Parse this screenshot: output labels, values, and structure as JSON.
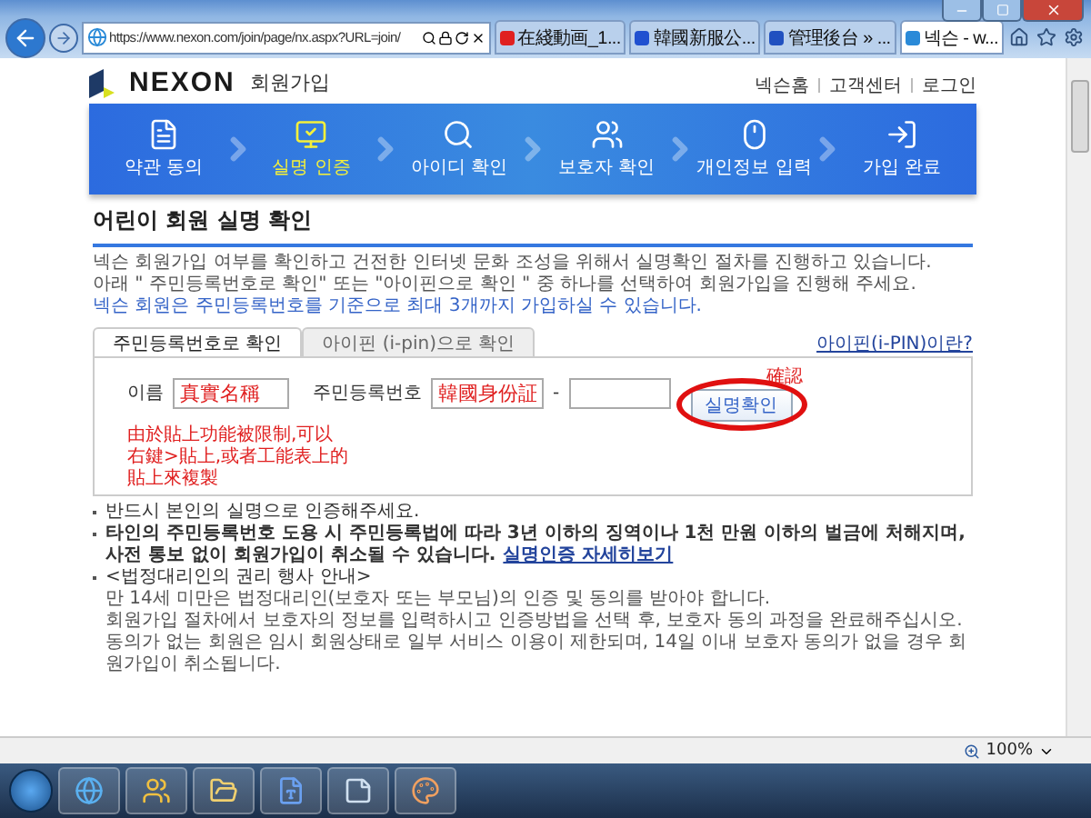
{
  "browser": {
    "url": "https://www.nexon.com/join/page/nx.aspx?URL=join/",
    "tabs": [
      {
        "label": "在綫動画_1...",
        "selected": false,
        "color": "#e02020"
      },
      {
        "label": "韓國新服公...",
        "selected": false,
        "color": "#2050d0"
      },
      {
        "label": "管理後台 » ...",
        "selected": false,
        "color": "#2050c0"
      },
      {
        "label": "넥슨 - w...",
        "selected": true,
        "color": "#2a8ad8"
      }
    ],
    "zoom": "100%"
  },
  "page": {
    "logo": "NEXON",
    "logo_subtitle": "회원가입",
    "top_links": [
      "넥슨홈",
      "고객센터",
      "로그인"
    ],
    "steps": [
      {
        "label": "약관 동의",
        "selected": false,
        "kind": "document"
      },
      {
        "label": "실명 인증",
        "selected": true,
        "kind": "monitor"
      },
      {
        "label": "아이디 확인",
        "selected": false,
        "kind": "search"
      },
      {
        "label": "보호자 확인",
        "selected": false,
        "kind": "people"
      },
      {
        "label": "개인정보 입력",
        "selected": false,
        "kind": "mouse"
      },
      {
        "label": "가입 완료",
        "selected": false,
        "kind": "enter"
      }
    ],
    "title": "어린이 회원 실명 확인",
    "intro": [
      {
        "text": "넥슨 회원가입 여부를 확인하고 건전한 인터넷 문화 조성을 위해서 실명확인 절차를 진행하고 있습니다.",
        "kind": "plain"
      },
      {
        "text": "아래 \" 주민등록번호로 확인\" 또는 \"아이핀으로 확인 \" 중 하나를 선택하여 회원가입을 진행해 주세요.",
        "kind": "plain"
      },
      {
        "text": "넥슨 회원은 주민등록번호를 기준으로 최대 3개까지 가입하실 수 있습니다.",
        "kind": "highlight"
      }
    ],
    "id_tabs": [
      {
        "label": "주민등록번호로 확인",
        "selected": true
      },
      {
        "label": "아이핀 (i-pin)으로 확인",
        "selected": false
      }
    ],
    "ipin_link": "아이핀(i-PIN)이란?",
    "form": {
      "name_label": "이름",
      "name_value": "真實名稱",
      "rrn_label": "주민등록번호",
      "rrn_value": "韓國身份証",
      "separator": "-",
      "button": "실명확인"
    },
    "annotations": {
      "confirm": "確認",
      "note_lines": [
        "由於貼上功能被限制,可以",
        "右鍵>貼上,或者工能表上的",
        "貼上來複製"
      ]
    },
    "notices": [
      {
        "text": "반드시 본인의 실명으로 인증해주세요.",
        "kind": "plain"
      },
      {
        "text": "타인의 주민등록번호 도용 시 주민등록법에 따라 3년 이하의 징역이나 1천 만원 이하의 벌금에 처해지며, 사전 통보 없이 회원가입이 취소될 수 있습니다.",
        "kind": "strong",
        "link": "실명인증 자세히보기"
      },
      {
        "text": "<법정대리인의 권리 행사 안내>",
        "kind": "section",
        "lines": [
          "만 14세 미만은 법정대리인(보호자 또는 부모님)의 인증 및 동의를 받아야 합니다.",
          "회원가입 절차에서 보호자의 정보를 입력하시고 인증방법을 선택 후, 보호자 동의 과정을 완료해주십시오. 동의가 없는 회원은 임시 회원상태로 일부 서비스 이용이 제한되며, 14일 이내 보호자 동의가 없을 경우 회원가입이 취소됩니다."
        ]
      }
    ]
  }
}
